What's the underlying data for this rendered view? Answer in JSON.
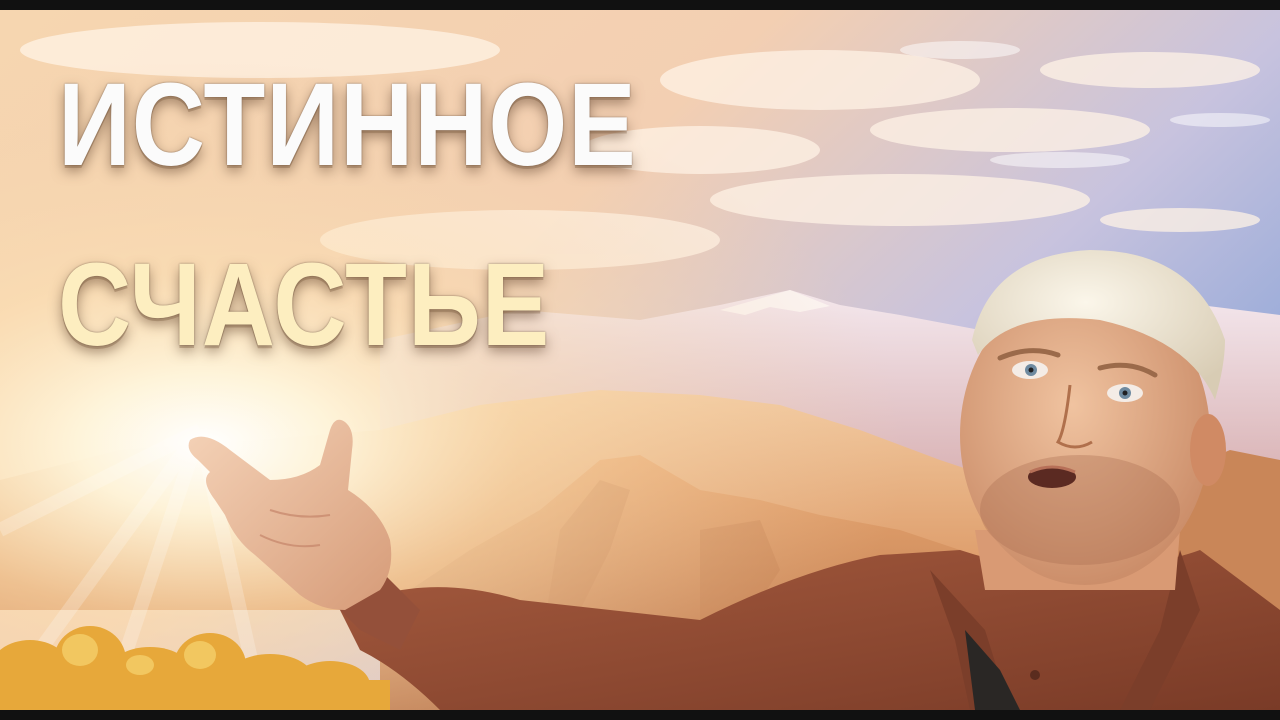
{
  "headline": {
    "line1": "ИСТИННОЕ",
    "line2": "СЧАСТЬЕ"
  },
  "colors": {
    "line1_text": "#fbfbfb",
    "line2_text": "#fdeec0",
    "shirt": "#8e4a33",
    "cap": "#efe7d6",
    "sky_blue": "#8fa6d8",
    "sun_glow": "#fff6dc"
  }
}
